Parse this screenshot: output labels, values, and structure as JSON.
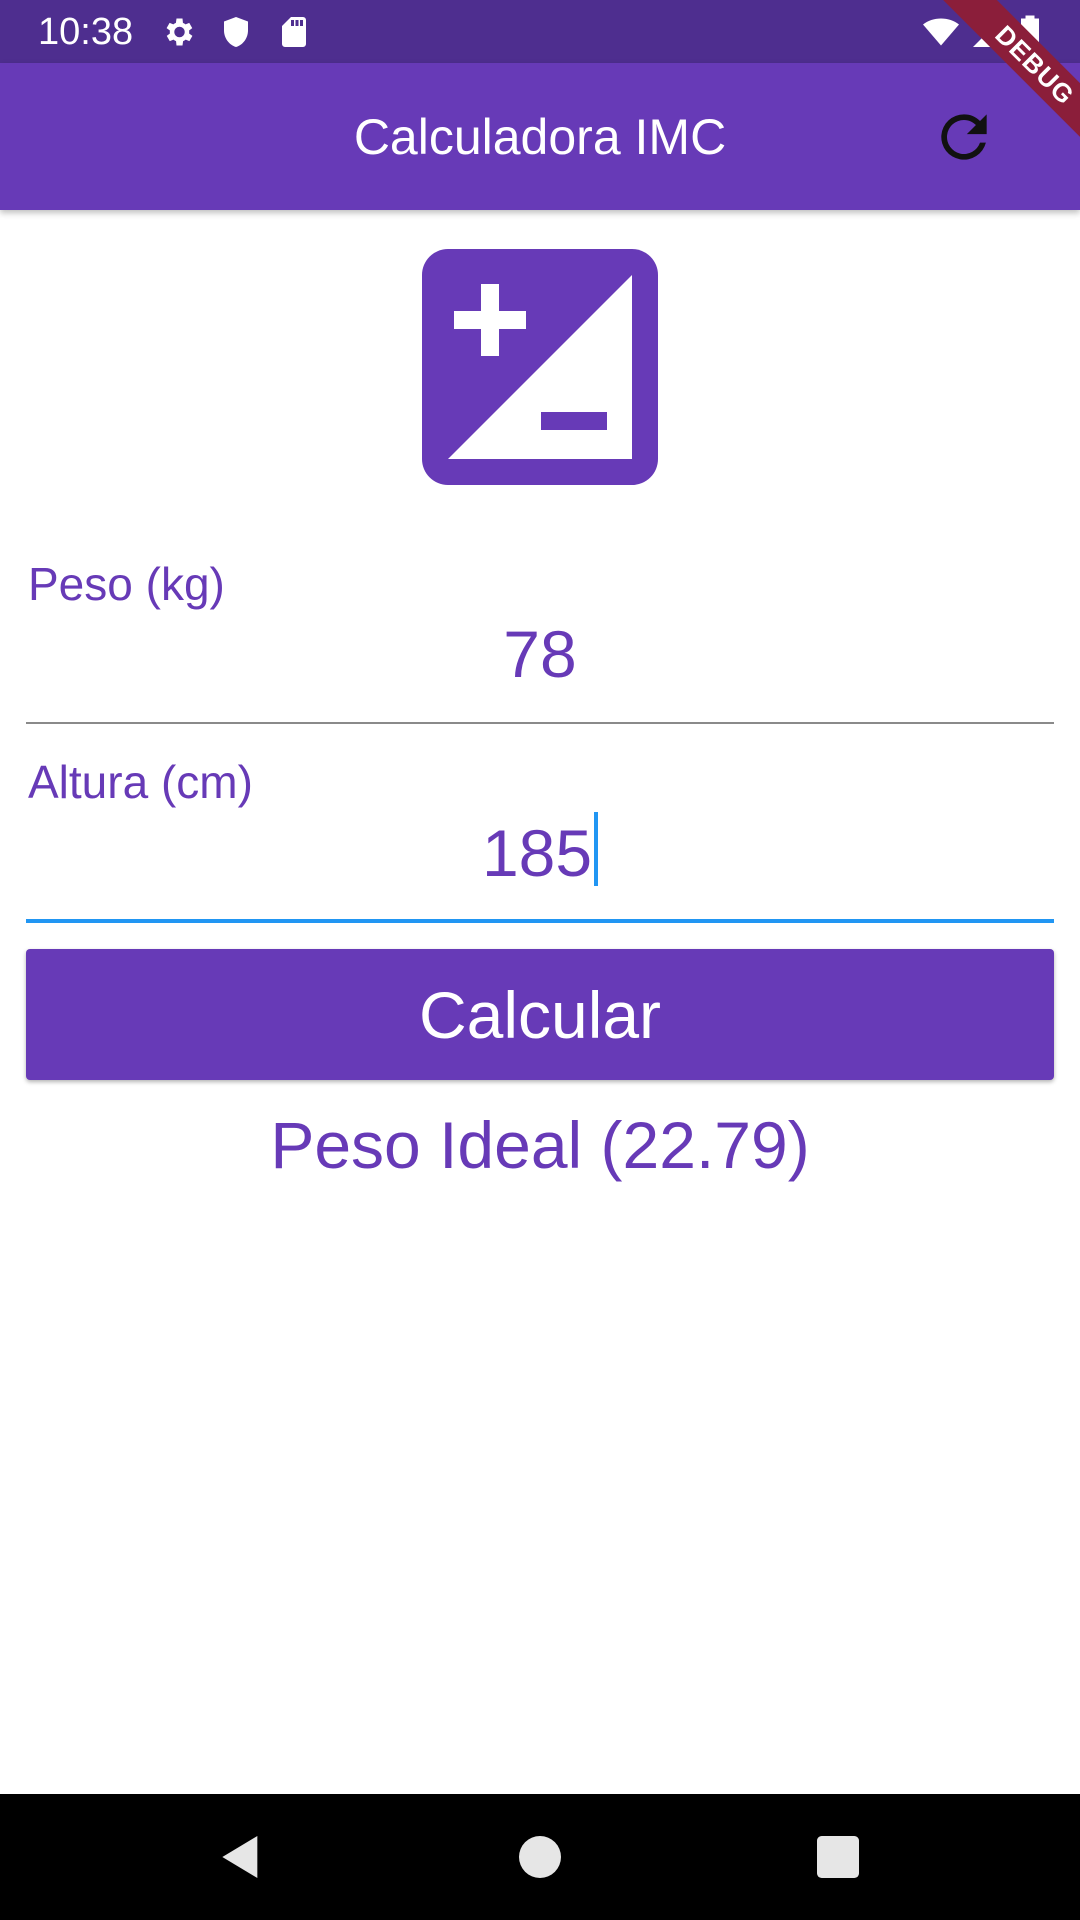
{
  "status_bar": {
    "time": "10:38",
    "left_icons": [
      "gear-icon",
      "shield-icon",
      "sd-card-icon"
    ],
    "right_icons": [
      "wifi-icon",
      "signal-icon",
      "battery-icon"
    ]
  },
  "app_bar": {
    "title": "Calculadora IMC",
    "action_icon": "refresh-icon",
    "debug_label": "DEBUG"
  },
  "logo_icon": "plus-minus-exposure-icon",
  "form": {
    "weight": {
      "label": "Peso (kg)",
      "value": "78"
    },
    "height": {
      "label": "Altura (cm)",
      "value": "185"
    },
    "submit_label": "Calcular",
    "result_text": "Peso Ideal (22.79)"
  },
  "nav_bar": {
    "icons": [
      "back-icon",
      "home-icon",
      "recents-icon"
    ]
  },
  "colors": {
    "primary": "#673ab7",
    "status_bar": "#4e2e8f",
    "focus": "#2196f3",
    "debug_ribbon": "#8b1e3a"
  }
}
